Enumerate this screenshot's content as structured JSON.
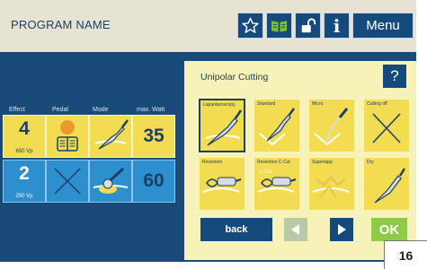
{
  "header": {
    "program_name": "PROGRAM NAME",
    "favorite_icon": "star-icon",
    "book_icon": "open-book-icon",
    "lock_icon": "unlocked-padlock-icon",
    "info_label": "i",
    "menu_label": "Menu"
  },
  "settings_table": {
    "headers": [
      "Effect",
      "Pedal",
      "Mode",
      "max. Watt"
    ],
    "rows": [
      {
        "effect": "4",
        "effect_sub": "650 Vp",
        "pedal_icon": "pedal-icon",
        "mode_icon": "cutting-scalpel-icon",
        "watt": "35",
        "color": "#f2dc52"
      },
      {
        "effect": "2",
        "effect_sub": "250 Vp",
        "pedal_icon": "cross-icon",
        "mode_icon": "ball-electrode-icon",
        "watt": "60",
        "color": "#2e8fce"
      }
    ]
  },
  "panel": {
    "title": "Unipolar Cutting",
    "help_label": "?",
    "modes": [
      {
        "label": "Lapantaroscopy"
      },
      {
        "label": "Standard"
      },
      {
        "label": "Micro"
      },
      {
        "label": "Cutting off"
      },
      {
        "label": "Resection"
      },
      {
        "label": "Resection C-Cut"
      },
      {
        "label": "Superlapp"
      },
      {
        "label": "Dry"
      }
    ],
    "back_label": "back",
    "ok_label": "OK",
    "prev_icon": "triangle-left-icon",
    "next_icon": "triangle-right-icon",
    "tile_c_cut_text": "C-Cut"
  },
  "page_number": "16",
  "colors": {
    "accent": "#154a7c",
    "panel": "#f7f2b7",
    "yellow": "#f2dc52",
    "blue": "#2e8fce",
    "ok_green": "#8ecb47"
  }
}
